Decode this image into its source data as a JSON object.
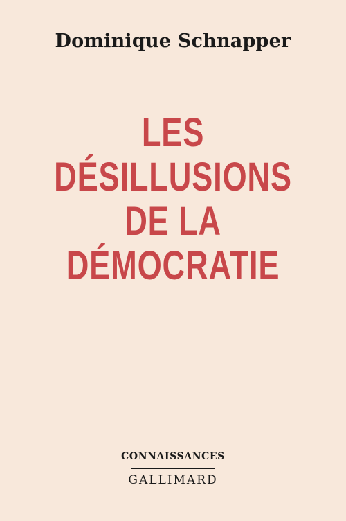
{
  "cover": {
    "author": "Dominique Schnapper",
    "title_lines": [
      "LES DÉSILLUSIONS",
      "DE LA",
      "DÉMOCRATIE"
    ],
    "series": "CONNAISSANCES",
    "publisher": "GALLIMARD"
  },
  "colors": {
    "background": "#f8e8db",
    "title": "#c8474a",
    "text": "#1a1a1a"
  }
}
